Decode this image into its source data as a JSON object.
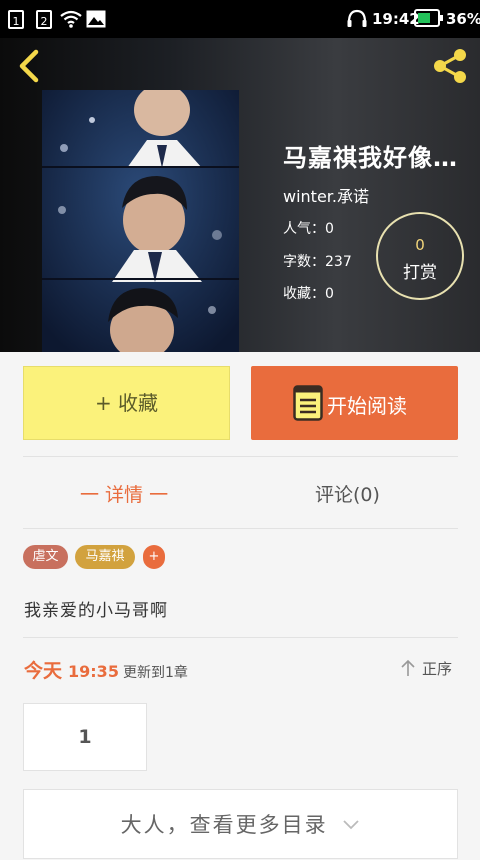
{
  "status_bar": {
    "sim1": "1",
    "sim2": "2",
    "time": "19:42",
    "battery": "36%"
  },
  "book": {
    "title": "马嘉祺我好像…",
    "author": "winter.承诺",
    "popularity_label": "人气：",
    "popularity": "0",
    "words_label": "字数：",
    "words": "237",
    "favorites_label": "收藏：",
    "favorites": "0"
  },
  "tip": {
    "count": "0",
    "label": "打赏"
  },
  "actions": {
    "favorite": "+ 收藏",
    "read": "开始阅读"
  },
  "tabs": {
    "details": "一 详情 一",
    "comments": "评论(0)"
  },
  "tags": [
    "虐文",
    "马嘉祺",
    "+"
  ],
  "description": "我亲爱的小马哥啊",
  "update": {
    "day": "今天",
    "time": "19:35",
    "text": "更新到1章"
  },
  "sort_label": "正序",
  "chapters": [
    "1"
  ],
  "more_catalog": "大人，查看更多目录",
  "colors": {
    "accent": "#e96c3d",
    "favorite_bg": "#fbf27b",
    "tag1": "#c8705e",
    "tag2": "#d2a23e",
    "tag3": "#e96c3d"
  },
  "icons": [
    "back-arrow-icon",
    "share-icon",
    "book-icon",
    "up-arrow-icon",
    "chevron-down-icon",
    "wifi-icon",
    "gallery-icon",
    "headset-icon",
    "battery-icon"
  ]
}
